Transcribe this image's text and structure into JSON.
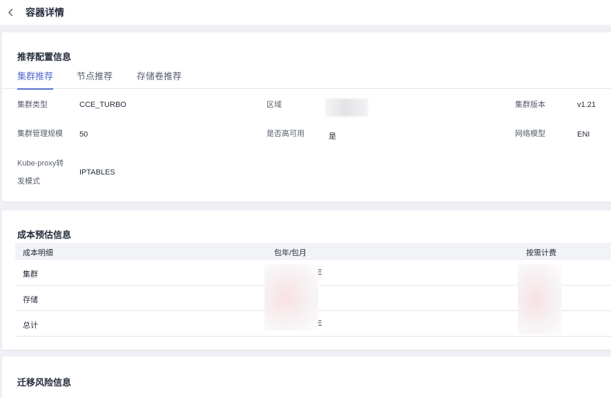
{
  "header": {
    "title": "容器详情"
  },
  "config": {
    "section_title": "推荐配置信息",
    "tabs": [
      {
        "label": "集群推荐",
        "active": true
      },
      {
        "label": "节点推荐",
        "active": false
      },
      {
        "label": "存储卷推荐",
        "active": false
      }
    ],
    "fields": {
      "cluster_type_label": "集群类型",
      "cluster_type_value": "CCE_TURBO",
      "region_label": "区域",
      "cluster_version_label": "集群版本",
      "cluster_version_value": "v1.21",
      "scale_label": "集群管理规模",
      "scale_value": "50",
      "ha_label": "是否高可用",
      "ha_value": "是",
      "network_label": "网络模型",
      "network_value": "ENI",
      "kube_proxy_label_1": "Kube-proxy转",
      "kube_proxy_label_2": "发模式",
      "kube_proxy_value": "IPTABLES"
    }
  },
  "cost": {
    "section_title": "成本预估信息",
    "columns": [
      "成本明细",
      "包年/包月",
      "按需计费"
    ],
    "rows": [
      {
        "item": "集群",
        "yearly_suffix": "E"
      },
      {
        "item": "存储",
        "yearly_suffix": ""
      },
      {
        "item": "总计",
        "yearly_suffix": "E"
      }
    ]
  },
  "risk": {
    "section_title": "迁移风险信息"
  },
  "colors": {
    "accent": "#526ecc",
    "background": "#eef0f5",
    "table_header": "#f2f3f6"
  }
}
